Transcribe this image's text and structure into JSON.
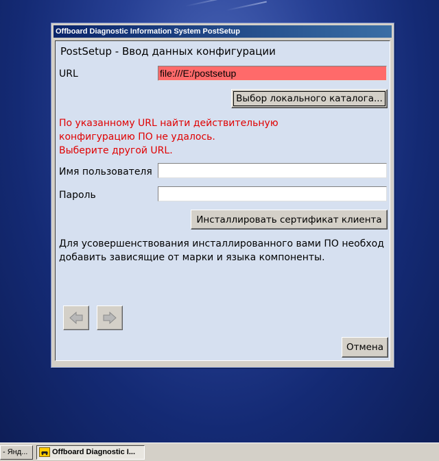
{
  "window": {
    "title": "Offboard Diagnostic Information System PostSetup"
  },
  "page": {
    "heading": "PostSetup - Ввод данных конфигурации"
  },
  "url": {
    "label": "URL",
    "value": "file:///E:/postsetup",
    "error_color": "#ff6a6a"
  },
  "buttons": {
    "browse_local": "Выбор локального каталога...",
    "install_cert": "Инсталлировать сертификат клиента",
    "cancel": "Отмена"
  },
  "error": {
    "lines": [
      "По указанному URL найти действительную",
      "конфигурацию ПО не удалось.",
      "Выберите другой URL."
    ],
    "color": "#e00000"
  },
  "username": {
    "label": "Имя пользователя",
    "value": ""
  },
  "password": {
    "label": "Пароль",
    "value": ""
  },
  "info": {
    "lines": [
      "Для усовершенствования инсталлированного вами ПО необход",
      "добавить зависящие от марки и языка компоненты."
    ]
  },
  "nav": {
    "back_icon": "arrow-left-icon",
    "forward_icon": "arrow-right-icon"
  },
  "taskbar": {
    "items": [
      {
        "label": "- Янд..."
      },
      {
        "label": "Offboard Diagnostic I..."
      }
    ]
  }
}
